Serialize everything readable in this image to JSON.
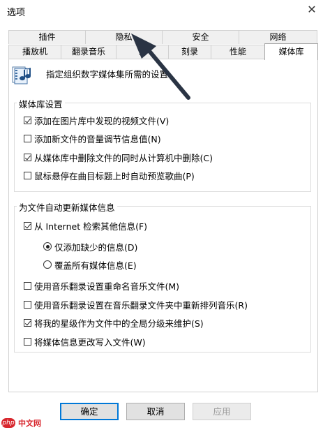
{
  "window": {
    "title": "选项",
    "close_glyph": "✕"
  },
  "tabs_row1": [
    {
      "label": "插件",
      "active": false
    },
    {
      "label": "隐私",
      "active": false
    },
    {
      "label": "安全",
      "active": false
    },
    {
      "label": "网络",
      "active": false
    }
  ],
  "tabs_row2": [
    {
      "label": "播放机",
      "active": false
    },
    {
      "label": "翻录音乐",
      "active": false
    },
    {
      "label": "设",
      "active": false
    },
    {
      "label": "刻录",
      "active": false
    },
    {
      "label": "性能",
      "active": false
    },
    {
      "label": "媒体库",
      "active": true
    }
  ],
  "header": {
    "icon": "media-library-icon",
    "description": "指定组织数字媒体集所需的设置。"
  },
  "group_media_library": {
    "legend": "媒体库设置",
    "options": [
      {
        "label": "添加在图片库中发现的视频文件(V)",
        "checked": true
      },
      {
        "label": "添加新文件的音量调节信息值(N)",
        "checked": false
      },
      {
        "label": "从媒体库中删除文件的同时从计算机中删除(C)",
        "checked": true
      },
      {
        "label": "鼠标悬停在曲目标题上时自动预览歌曲(P)",
        "checked": false
      }
    ]
  },
  "group_auto_update": {
    "legend": "为文件自动更新媒体信息",
    "retrieve": {
      "label": "从 Internet 检索其他信息(F)",
      "checked": true
    },
    "radios": [
      {
        "label": "仅添加缺少的信息(D)",
        "checked": true
      },
      {
        "label": "覆盖所有媒体信息(E)",
        "checked": false
      }
    ],
    "options": [
      {
        "label": "使用音乐翻录设置重命名音乐文件(M)",
        "checked": false
      },
      {
        "label": "使用音乐翻录设置在音乐翻录文件夹中重新排列音乐(R)",
        "checked": false
      },
      {
        "label": "将我的星级作为文件中的全局分级来维护(S)",
        "checked": true
      },
      {
        "label": "将媒体信息更改写入文件(W)",
        "checked": false
      }
    ]
  },
  "buttons": {
    "ok": "确定",
    "cancel": "取消",
    "apply": "应用"
  },
  "watermark": {
    "logo": "php",
    "text": "中文网"
  },
  "colors": {
    "accent": "#0078d7",
    "arrow": "#2a3444",
    "watermark": "#d8262d"
  }
}
